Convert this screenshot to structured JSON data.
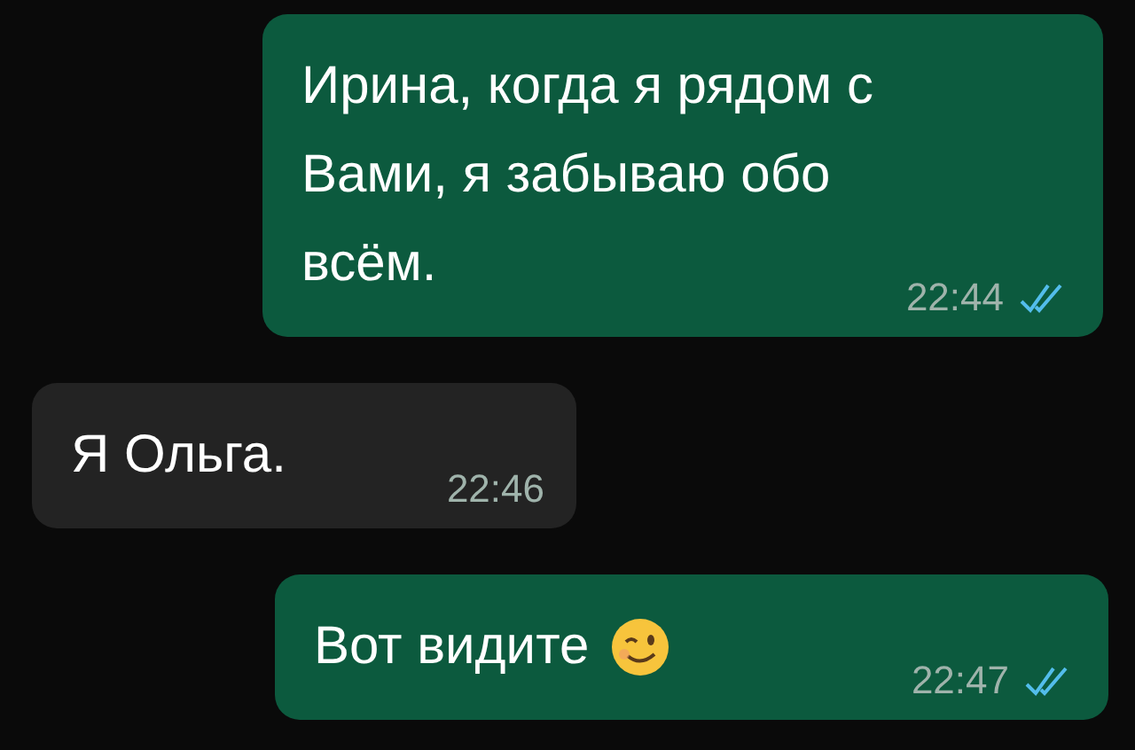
{
  "messages": [
    {
      "kind": "out",
      "lines": [
        "Ирина, когда я рядом с",
        "Вами, я забываю обо",
        "всём."
      ],
      "time": "22:44",
      "read": true,
      "emoji": false
    },
    {
      "kind": "in",
      "lines": [
        "Я Ольга."
      ],
      "time": "22:46",
      "emoji": false
    },
    {
      "kind": "out",
      "lines": [
        "Вот видите"
      ],
      "time": "22:47",
      "read": true,
      "emoji": true
    }
  ]
}
